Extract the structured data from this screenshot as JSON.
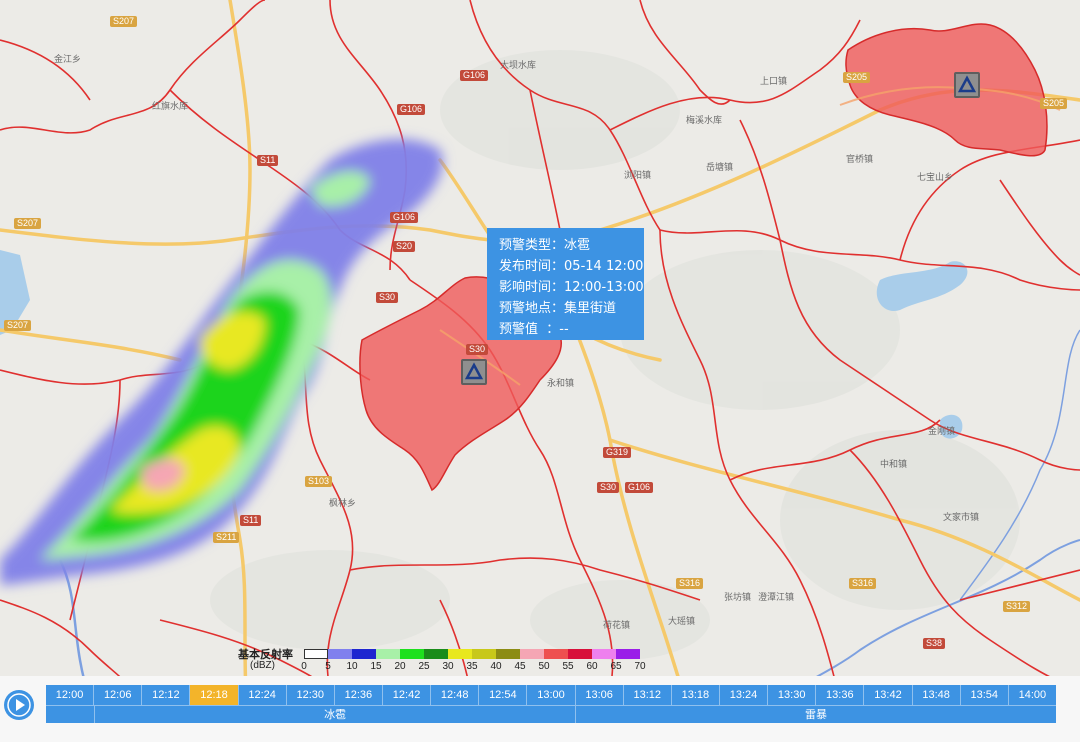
{
  "popup": {
    "rows": [
      {
        "key": "预警类型",
        "value": "冰雹"
      },
      {
        "key": "发布时间",
        "value": "05-14 12:00"
      },
      {
        "key": "影响时间",
        "value": "12:00-13:00"
      },
      {
        "key": "预警地点",
        "value": "集里街道"
      },
      {
        "key": "预警值",
        "value": "--"
      }
    ]
  },
  "legend": {
    "title": "基本反射率",
    "unit": "(dBZ)",
    "ticks": [
      "0",
      "5",
      "10",
      "15",
      "20",
      "25",
      "30",
      "35",
      "40",
      "45",
      "50",
      "55",
      "60",
      "65",
      "70"
    ],
    "colors": [
      "#ffffff",
      "#8080ee",
      "#1e26d0",
      "#a8f0a8",
      "#1ee01e",
      "#1a8c1a",
      "#e8e81e",
      "#c8c81a",
      "#8c8c14",
      "#f5a6b4",
      "#ee5050",
      "#d8103a",
      "#ee80ee",
      "#9a1ee8"
    ]
  },
  "timeline": {
    "times": [
      "12:00",
      "12:06",
      "12:12",
      "12:18",
      "12:24",
      "12:30",
      "12:36",
      "12:42",
      "12:48",
      "12:54",
      "13:00",
      "13:06",
      "13:12",
      "13:18",
      "13:24",
      "13:30",
      "13:36",
      "13:42",
      "13:48",
      "13:54",
      "14:00"
    ],
    "active_index": 3,
    "types": [
      {
        "label": "冰雹",
        "start": 1,
        "end": 11
      },
      {
        "label": "雷暴",
        "start": 11,
        "end": 21
      }
    ]
  },
  "map": {
    "road_labels": [
      {
        "text": "S207",
        "kind": "prov"
      },
      {
        "text": "G106",
        "kind": "nat"
      },
      {
        "text": "G106",
        "kind": "nat"
      },
      {
        "text": "S11",
        "kind": "nat"
      },
      {
        "text": "S207",
        "kind": "prov"
      },
      {
        "text": "G106",
        "kind": "nat"
      },
      {
        "text": "S20",
        "kind": "nat"
      },
      {
        "text": "S30",
        "kind": "nat"
      },
      {
        "text": "S207",
        "kind": "prov"
      },
      {
        "text": "S30",
        "kind": "nat"
      },
      {
        "text": "G319",
        "kind": "nat"
      },
      {
        "text": "S30",
        "kind": "nat"
      },
      {
        "text": "G106",
        "kind": "nat"
      },
      {
        "text": "S103",
        "kind": "prov"
      },
      {
        "text": "S11",
        "kind": "nat"
      },
      {
        "text": "S211",
        "kind": "prov"
      },
      {
        "text": "S316",
        "kind": "prov"
      },
      {
        "text": "S316",
        "kind": "prov"
      },
      {
        "text": "S312",
        "kind": "prov"
      },
      {
        "text": "S38",
        "kind": "nat"
      },
      {
        "text": "S205",
        "kind": "prov"
      },
      {
        "text": "S205",
        "kind": "prov"
      }
    ],
    "place_labels": [
      "金江乡",
      "红旗水库",
      "大坝水库",
      "梅溪水库",
      "上口镇",
      "岳塘镇",
      "浏阳镇",
      "七宝山乡",
      "官桥镇",
      "永和镇",
      "中和镇",
      "文家市镇",
      "张坊镇",
      "澄潭江镇",
      "枫林乡",
      "大瑶镇",
      "金刚镇",
      "荷花镇"
    ],
    "warning_markers": [
      {
        "name": "hail-warning",
        "icon": "triangle-icon"
      },
      {
        "name": "thunder-warning",
        "icon": "triangle-icon"
      }
    ]
  }
}
